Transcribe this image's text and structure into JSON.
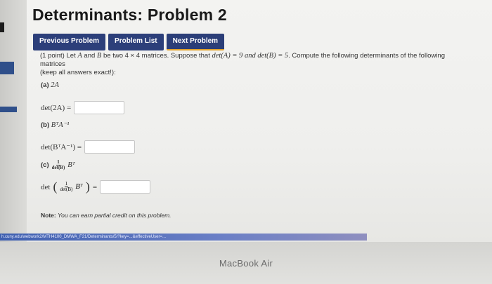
{
  "page": {
    "title": "Determinants: Problem 2"
  },
  "nav": {
    "previous": "Previous Problem",
    "list": "Problem List",
    "next": "Next Problem"
  },
  "problem": {
    "points": "(1 point)",
    "intro_pre": "Let",
    "A": "A",
    "and": "and",
    "B": "B",
    "be_two": "be two",
    "size": "4 × 4",
    "intro_mid": "matrices. Suppose that",
    "detA": "det(A) = 9",
    "detB": "and det(B) = 5",
    "intro_post": ". Compute the following determinants of the following matrices",
    "keep_exact": "(keep all answers exact!):"
  },
  "parts": {
    "a_label": "(a)",
    "a_expr": "2A",
    "a_eq": "det(2A) =",
    "b_label": "(b)",
    "b_expr": "BᵀA⁻¹",
    "b_eq": "det(BᵀA⁻¹) =",
    "c_label": "(c)",
    "c_frac_num": "1",
    "c_frac_den": "det(B)",
    "c_expr": "Bᵀ",
    "c_eq_det": "det",
    "c_eq_tail": "="
  },
  "answers": {
    "a": "",
    "b": "",
    "c": ""
  },
  "note": {
    "label": "Note:",
    "text": "You can earn partial credit on this problem."
  },
  "url": "h.cuny.edu/webwork2/MTH4100_DMWA_F21/Determinants/5/?key=...&effectiveUser=...",
  "device": {
    "brand": "MacBook Air"
  }
}
